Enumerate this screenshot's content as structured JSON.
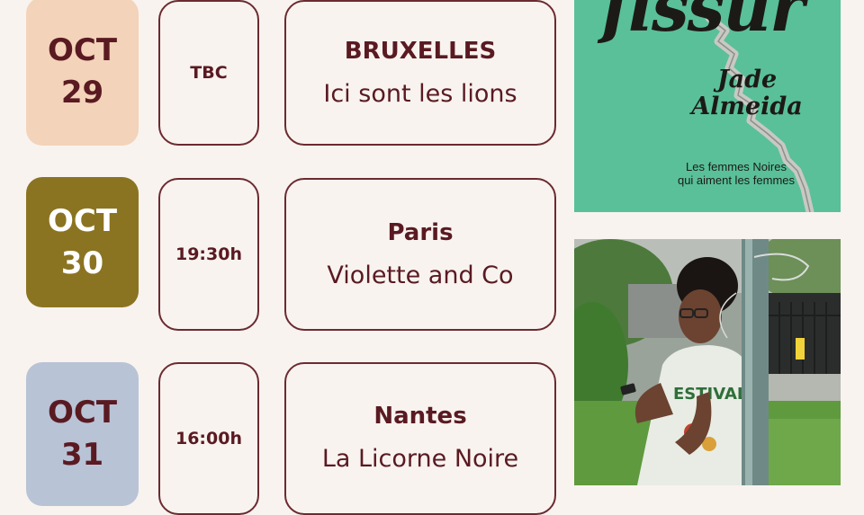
{
  "events": [
    {
      "month": "OCT",
      "day": "29",
      "time": "TBC",
      "city": "BRUXELLES",
      "venue": "Ici sont les lions",
      "color": "#f3d3b9"
    },
    {
      "month": "OCT",
      "day": "30",
      "time": "19:30h",
      "city": "Paris",
      "venue": "Violette and Co",
      "color": "#8b7421"
    },
    {
      "month": "OCT",
      "day": "31",
      "time": "16:00h",
      "city": "Nantes",
      "venue": "La Licorne Noire",
      "color": "#b8c3d6"
    }
  ],
  "book": {
    "title": "fissur",
    "author_first": "Jade",
    "author_last": "Almeida",
    "subtitle_line1": "Les femmes Noires",
    "subtitle_line2": "qui aiment les femmes",
    "cover_color": "#59c09a"
  },
  "photo": {
    "shirt_text": "ESTIVAL"
  },
  "colors": {
    "accent": "#5a1a22",
    "background": "#f8f3ef"
  }
}
